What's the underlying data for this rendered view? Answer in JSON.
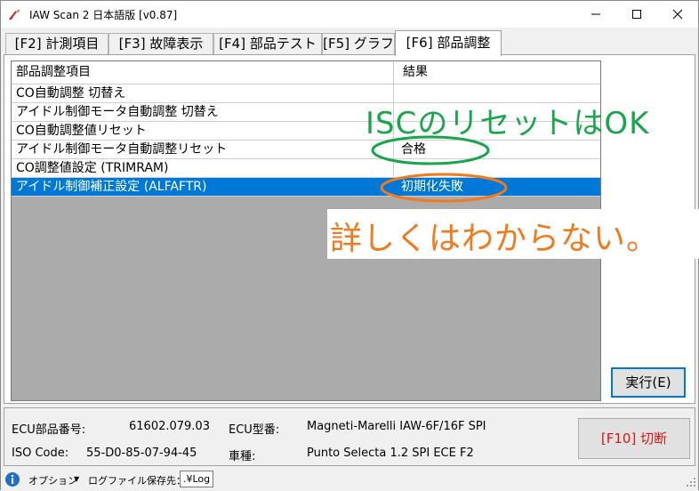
{
  "window": {
    "title": "IAW Scan 2 日本語版 [v0.87]"
  },
  "tabs": [
    {
      "label": "[F2] 計測項目",
      "active": false
    },
    {
      "label": "[F3] 故障表示",
      "active": false
    },
    {
      "label": "[F4] 部品テスト",
      "active": false
    },
    {
      "label": "[F5] グラフ",
      "active": false
    },
    {
      "label": "[F6] 部品調整",
      "active": true
    }
  ],
  "grid": {
    "headers": [
      "部品調整項目",
      "結果"
    ],
    "rows": [
      {
        "item": "CO自動調整 切替え",
        "result": ""
      },
      {
        "item": "アイドル制御モータ自動調整 切替え",
        "result": ""
      },
      {
        "item": "CO自動調整値リセット",
        "result": ""
      },
      {
        "item": "アイドル制御モータ自動調整リセット",
        "result": "合格"
      },
      {
        "item": "CO調整値設定 (TRIMRAM)",
        "result": ""
      },
      {
        "item": "アイドル制御補正設定 (ALFAFTR)",
        "result": "初期化失敗",
        "selected": true
      }
    ]
  },
  "annotations": {
    "green_text": "ISCのリセットはOK",
    "orange_text": "詳しくはわからない。",
    "green_color": "#19a64a",
    "orange_color": "#f07a1e"
  },
  "execute_button": {
    "label": "実行(E)"
  },
  "info": {
    "ecu_part_label": "ECU部品番号:",
    "ecu_part_value": "61602.079.03",
    "ecu_model_label": "ECU型番:",
    "ecu_model_value": "Magneti-Marelli IAW-6F/16F SPI",
    "iso_label": "ISO Code:",
    "iso_value": "55-D0-85-07-94-45",
    "vehicle_label": "車種:",
    "vehicle_value": "Punto Selecta 1.2 SPI ECE F2"
  },
  "disconnect_button": {
    "label": "[F10] 切断",
    "color": "#d01818"
  },
  "statusbar": {
    "option_label": "オプション",
    "log_dest_label": "ログファイル保存先：",
    "log_path": ".¥Log"
  },
  "colors": {
    "selection": "#0078d7",
    "grid_background": "#ababab"
  }
}
